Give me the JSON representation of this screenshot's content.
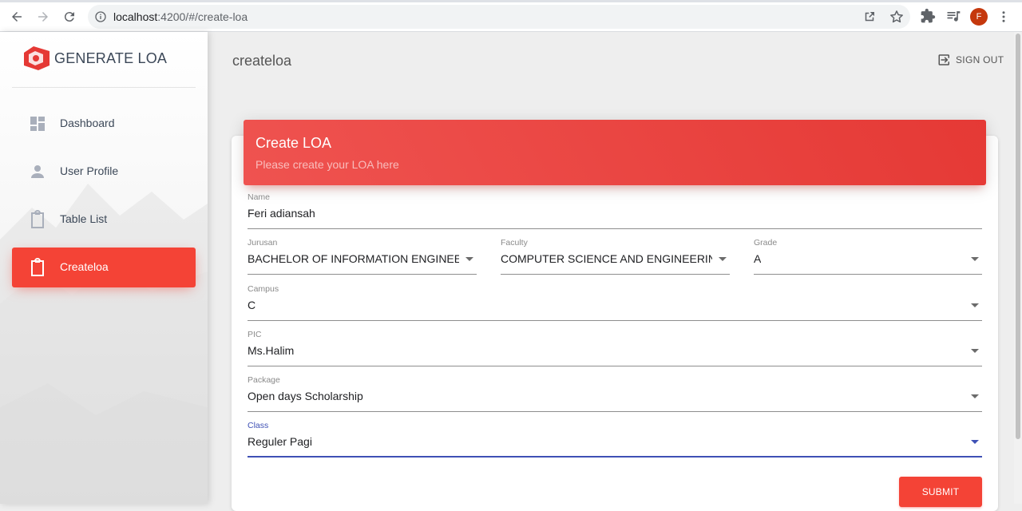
{
  "browser": {
    "url_host": "localhost",
    "url_rest": ":4200/#/create-loa",
    "profile_initial": "F"
  },
  "sidebar": {
    "logo_text": "GENERATE LOA",
    "items": [
      {
        "label": "Dashboard",
        "icon": "dashboard-icon",
        "active": false
      },
      {
        "label": "User Profile",
        "icon": "person-icon",
        "active": false
      },
      {
        "label": "Table List",
        "icon": "clipboard-icon",
        "active": false
      },
      {
        "label": "Createloa",
        "icon": "clipboard-icon",
        "active": true
      }
    ]
  },
  "header": {
    "page_title": "createloa",
    "signout_label": "SIGN OUT"
  },
  "card": {
    "title": "Create LOA",
    "subtitle": "Please create your LOA here"
  },
  "form": {
    "name": {
      "label": "Name",
      "value": "Feri adiansah"
    },
    "jurusan": {
      "label": "Jurusan",
      "value": "BACHELOR OF INFORMATION ENGINEER..."
    },
    "faculty": {
      "label": "Faculty",
      "value": "COMPUTER SCIENCE AND ENGINEERING"
    },
    "grade": {
      "label": "Grade",
      "value": "A"
    },
    "campus": {
      "label": "Campus",
      "value": "C"
    },
    "pic": {
      "label": "PIC",
      "value": "Ms.Halim"
    },
    "package": {
      "label": "Package",
      "value": "Open days Scholarship"
    },
    "class": {
      "label": "Class",
      "value": "Reguler Pagi"
    },
    "submit_label": "SUBMIT"
  },
  "colors": {
    "accent": "#f44336",
    "focus": "#3f51b5"
  }
}
